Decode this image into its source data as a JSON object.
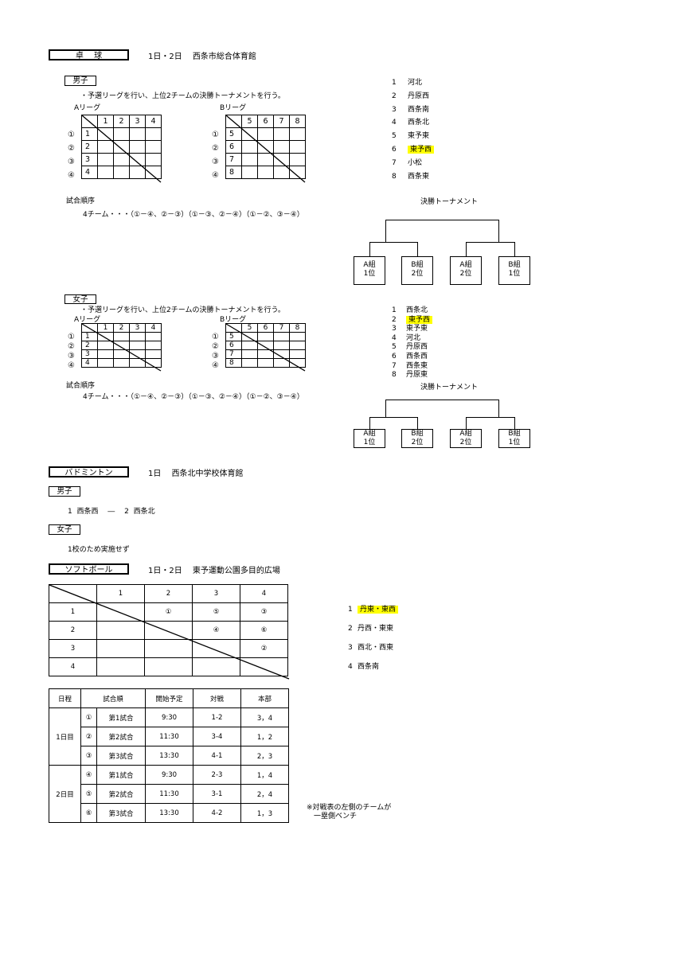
{
  "table_tennis": {
    "title": "卓　 球",
    "venue": "1日・2日　 西条市総合体育館",
    "boys": {
      "label": "男子",
      "description": "・予選リーグを行い、上位2チームの決勝トーナメントを行う。",
      "league_a": {
        "label": "Aリーグ",
        "cols": [
          "1",
          "2",
          "3",
          "4"
        ],
        "rows": [
          "1",
          "2",
          "3",
          "4"
        ],
        "row_marks": [
          "①",
          "②",
          "③",
          "④"
        ]
      },
      "league_b": {
        "label": "Bリーグ",
        "cols": [
          "5",
          "6",
          "7",
          "8"
        ],
        "rows": [
          "5",
          "6",
          "7",
          "8"
        ],
        "row_marks": [
          "①",
          "②",
          "③",
          "④"
        ]
      },
      "order_label": "試合順序",
      "order_text": "4チーム・・・（①－④、②－③）（①－③、②－④）（①－②、③－④）",
      "teams": [
        {
          "num": "1",
          "name": "河北",
          "highlight": false
        },
        {
          "num": "2",
          "name": "丹原西",
          "highlight": false
        },
        {
          "num": "3",
          "name": "西条南",
          "highlight": false
        },
        {
          "num": "4",
          "name": "西条北",
          "highlight": false
        },
        {
          "num": "5",
          "name": "東予東",
          "highlight": false
        },
        {
          "num": "6",
          "name": "東予西",
          "highlight": true
        },
        {
          "num": "7",
          "name": "小松",
          "highlight": false
        },
        {
          "num": "8",
          "name": "西条東",
          "highlight": false
        }
      ],
      "tournament_title": "決勝トーナメント",
      "bracket": [
        {
          "line1": "A組",
          "line2": "1位"
        },
        {
          "line1": "B組",
          "line2": "2位"
        },
        {
          "line1": "A組",
          "line2": "2位"
        },
        {
          "line1": "B組",
          "line2": "1位"
        }
      ]
    },
    "girls": {
      "label": "女子",
      "description": "・予選リーグを行い、上位2チームの決勝トーナメントを行う。",
      "league_a": {
        "label": "Aリーグ",
        "cols": [
          "1",
          "2",
          "3",
          "4"
        ],
        "rows": [
          "1",
          "2",
          "3",
          "4"
        ],
        "row_marks": [
          "①",
          "②",
          "③",
          "④"
        ]
      },
      "league_b": {
        "label": "Bリーグ",
        "cols": [
          "5",
          "6",
          "7",
          "8"
        ],
        "rows": [
          "5",
          "6",
          "7",
          "8"
        ],
        "row_marks": [
          "①",
          "②",
          "③",
          "④"
        ]
      },
      "order_label": "試合順序",
      "order_text": "4チーム・・・（①－④、②－③）（①－③、②－④）（①－②、③－④）",
      "teams": [
        {
          "num": "1",
          "name": "西条北",
          "highlight": false
        },
        {
          "num": "2",
          "name": "東予西",
          "highlight": true
        },
        {
          "num": "3",
          "name": "東予東",
          "highlight": false
        },
        {
          "num": "4",
          "name": "河北",
          "highlight": false
        },
        {
          "num": "5",
          "name": "丹原西",
          "highlight": false
        },
        {
          "num": "6",
          "name": "西条西",
          "highlight": false
        },
        {
          "num": "7",
          "name": "西条東",
          "highlight": false
        },
        {
          "num": "8",
          "name": "丹原東",
          "highlight": false
        }
      ],
      "tournament_title": "決勝トーナメント",
      "bracket": [
        {
          "line1": "A組",
          "line2": "1位"
        },
        {
          "line1": "B組",
          "line2": "2位"
        },
        {
          "line1": "A組",
          "line2": "2位"
        },
        {
          "line1": "B組",
          "line2": "1位"
        }
      ]
    }
  },
  "badminton": {
    "title": "バドミントン",
    "venue": "1日　 西条北中学校体育館",
    "boys": {
      "label": "男子",
      "match": "1  西条西　 ―　 2  西条北"
    },
    "girls": {
      "label": "女子",
      "note": "1校のため実施せず"
    }
  },
  "softball": {
    "title": "ソフトボール",
    "venue": "1日・2日　 東予運動公園多目的広場",
    "matrix": {
      "cols": [
        "1",
        "2",
        "3",
        "4"
      ],
      "rows": [
        {
          "label": "1",
          "cells": [
            "",
            "①",
            "⑤",
            "③"
          ]
        },
        {
          "label": "2",
          "cells": [
            "",
            "",
            "④",
            "⑥"
          ]
        },
        {
          "label": "3",
          "cells": [
            "",
            "",
            "",
            "②"
          ]
        },
        {
          "label": "4",
          "cells": [
            "",
            "",
            "",
            ""
          ]
        }
      ]
    },
    "teams": [
      {
        "num": "1",
        "name": "丹東・東西",
        "highlight": true
      },
      {
        "num": "2",
        "name": "丹西・東東",
        "highlight": false
      },
      {
        "num": "3",
        "name": "西北・西東",
        "highlight": false
      },
      {
        "num": "4",
        "name": "西条南",
        "highlight": false
      }
    ],
    "schedule": {
      "headers": [
        "日程",
        "試合順",
        "開始予定",
        "対戦",
        "本部"
      ],
      "days": [
        {
          "day": "1日目",
          "games": [
            {
              "mark": "①",
              "game": "第1試合",
              "time": "9:30",
              "match": "1-2",
              "hq": "3，4"
            },
            {
              "mark": "②",
              "game": "第2試合",
              "time": "11:30",
              "match": "3-4",
              "hq": "1，2"
            },
            {
              "mark": "③",
              "game": "第3試合",
              "time": "13:30",
              "match": "4-1",
              "hq": "2，3"
            }
          ]
        },
        {
          "day": "2日目",
          "games": [
            {
              "mark": "④",
              "game": "第1試合",
              "time": "9:30",
              "match": "2-3",
              "hq": "1，4"
            },
            {
              "mark": "⑤",
              "game": "第2試合",
              "time": "11:30",
              "match": "3-1",
              "hq": "2，4"
            },
            {
              "mark": "⑥",
              "game": "第3試合",
              "time": "13:30",
              "match": "4-2",
              "hq": "1，3"
            }
          ]
        }
      ]
    },
    "note": "※対戦表の左側のチームが\n　一塁側ベンチ"
  }
}
